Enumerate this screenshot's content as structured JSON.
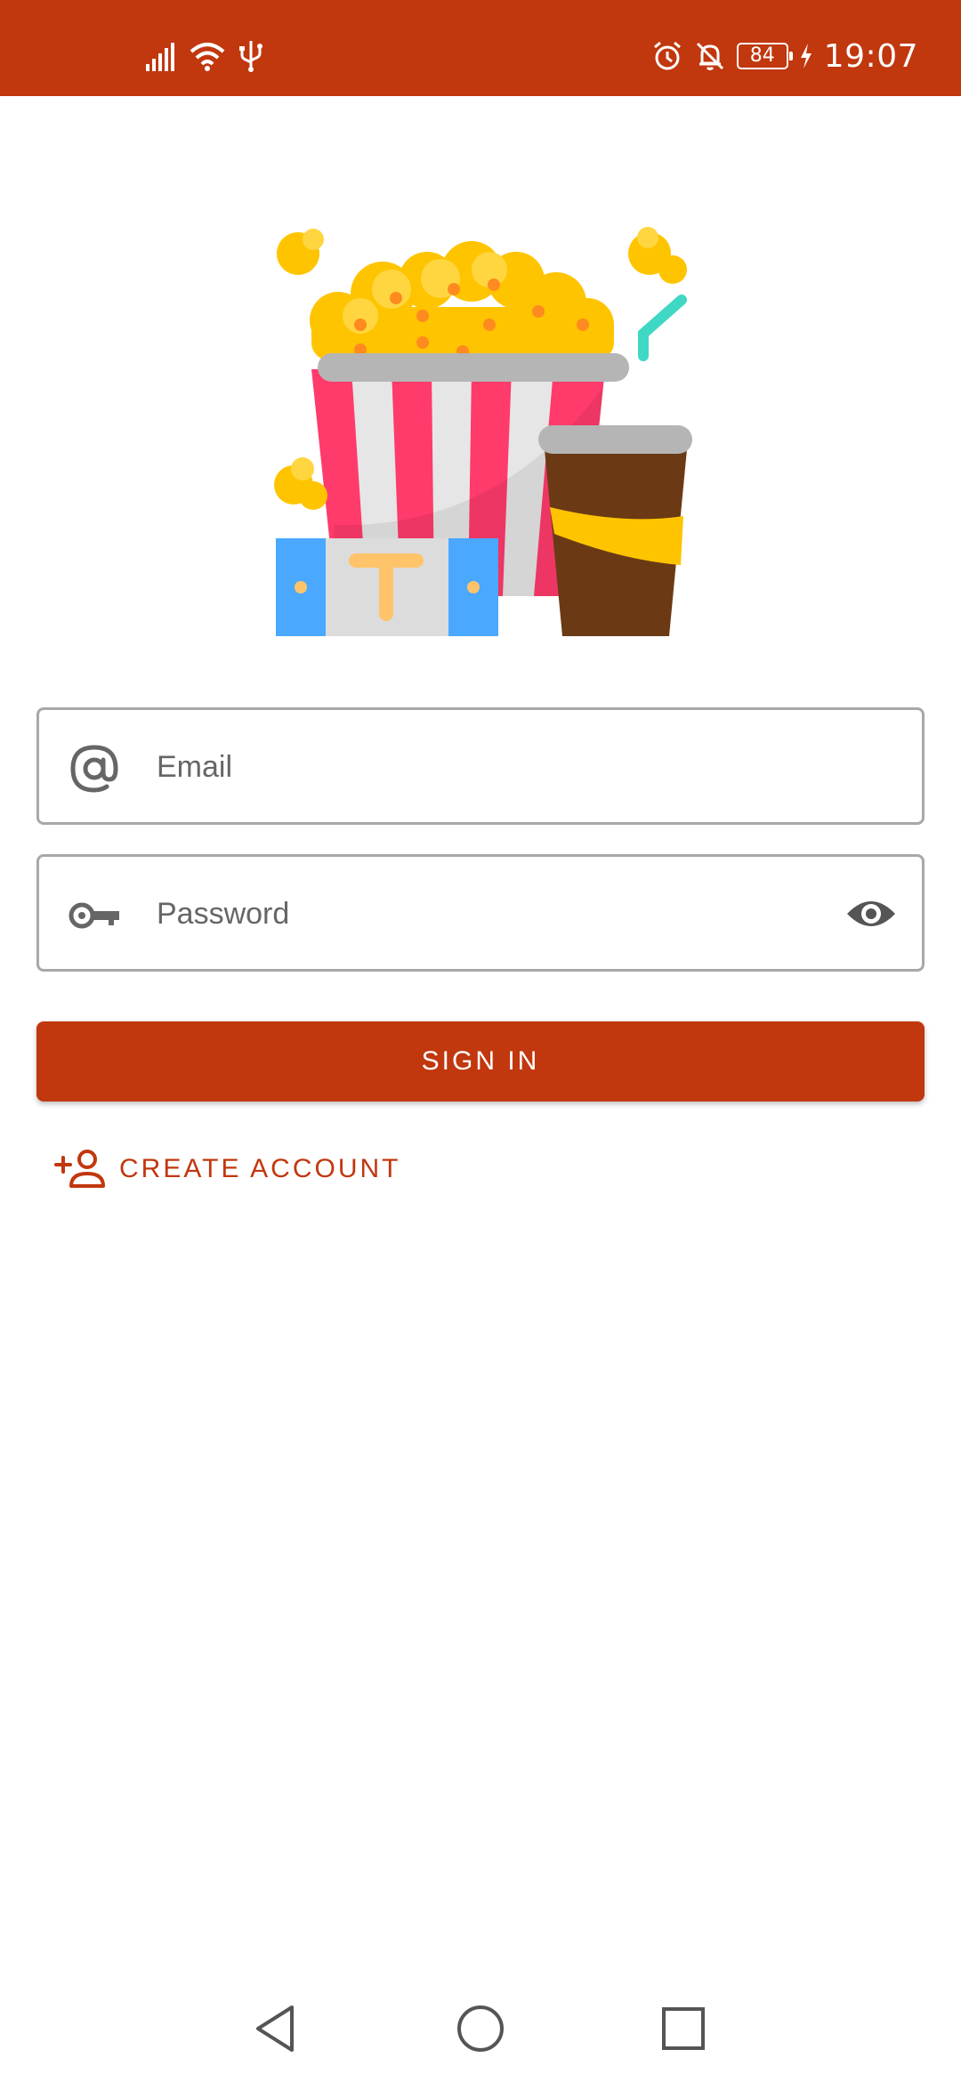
{
  "status_bar": {
    "time": "19:07",
    "battery": "84",
    "left_icons": [
      "signal-icon",
      "wifi-icon",
      "usb-icon"
    ],
    "right_icons": [
      "alarm-icon",
      "bell-off-icon",
      "battery-icon",
      "charging-icon"
    ]
  },
  "login": {
    "email_placeholder": "Email",
    "password_placeholder": "Password",
    "sign_in_label": "SIGN IN",
    "create_account_label": "CREATE ACCOUNT"
  },
  "colors": {
    "accent": "#c1370e",
    "field_border": "#a8a8a8",
    "icon_gray": "#666666"
  },
  "nav_bar": [
    "back-icon",
    "home-icon",
    "recents-icon"
  ]
}
